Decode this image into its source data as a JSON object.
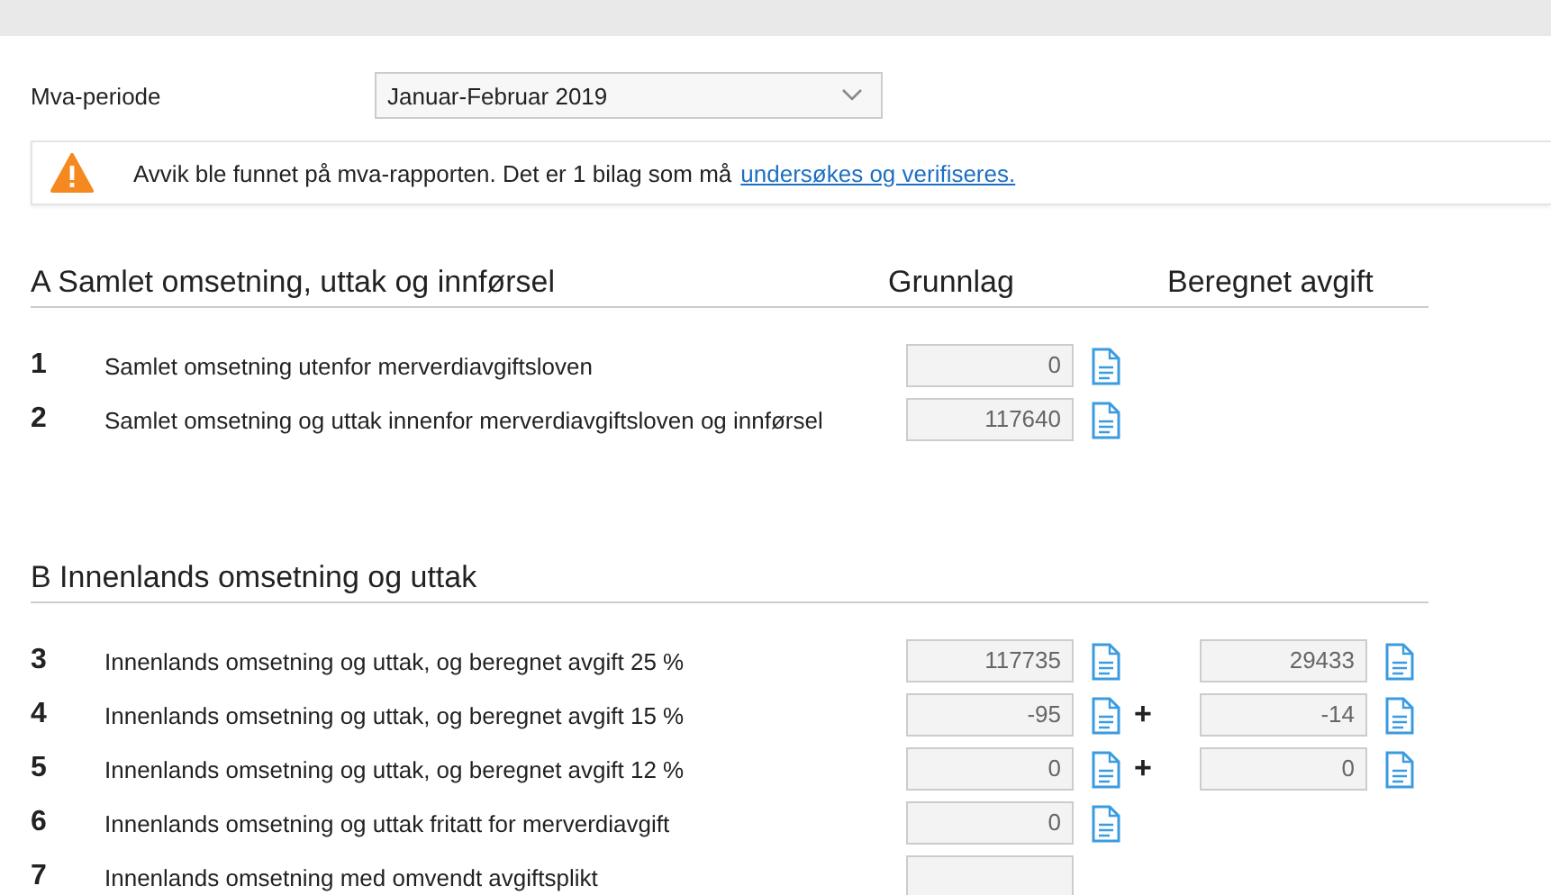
{
  "period": {
    "label": "Mva-periode",
    "value": "Januar-Februar 2019"
  },
  "alert": {
    "text": "Avvik ble funnet på mva-rapporten. Det er 1 bilag som må",
    "link": "undersøkes og verifiseres."
  },
  "sections": [
    {
      "title": "A Samlet omsetning, uttak og innførsel",
      "columns": [
        "Grunnlag",
        "Beregnet avgift"
      ],
      "rows": [
        {
          "number": "1",
          "label": "Samlet omsetning utenfor merverdiavgiftsloven",
          "grunnlag": {
            "value": "0",
            "document": true
          }
        },
        {
          "number": "2",
          "label": "Samlet omsetning og uttak innenfor merverdiavgiftsloven og innførsel",
          "grunnlag": {
            "value": "117640",
            "document": true
          }
        }
      ]
    },
    {
      "title": "B Innenlands omsetning og uttak",
      "rows": [
        {
          "number": "3",
          "label": "Innenlands omsetning og uttak, og beregnet avgift 25 %",
          "grunnlag": {
            "value": "117735",
            "document": true
          },
          "avgift": {
            "value": "29433",
            "document": true
          }
        },
        {
          "number": "4",
          "label": "Innenlands omsetning og uttak, og beregnet avgift 15 %",
          "grunnlag": {
            "value": "-95",
            "document": true
          },
          "operator": "+",
          "avgift": {
            "value": "-14",
            "document": true
          }
        },
        {
          "number": "5",
          "label": "Innenlands omsetning og uttak, og beregnet avgift 12 %",
          "grunnlag": {
            "value": "0",
            "document": true
          },
          "operator": "+",
          "avgift": {
            "value": "0",
            "document": true
          }
        },
        {
          "number": "6",
          "label": "Innenlands omsetning og uttak fritatt for merverdiavgift",
          "grunnlag": {
            "value": "0",
            "document": true
          }
        },
        {
          "number": "7",
          "label": "Innenlands omsetning med omvendt avgiftsplikt",
          "grunnlag": {
            "document": false
          }
        }
      ]
    }
  ]
}
